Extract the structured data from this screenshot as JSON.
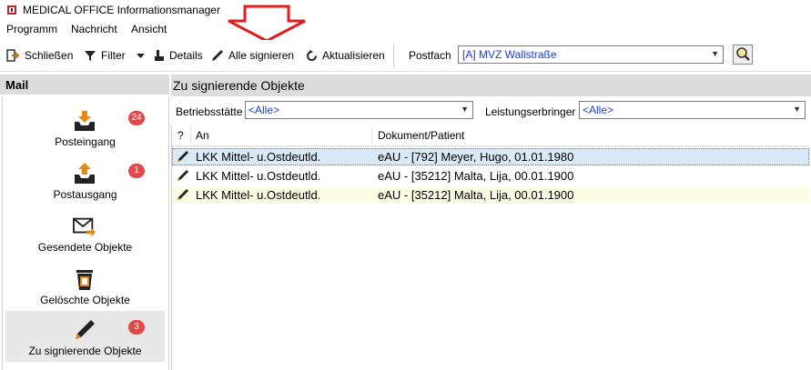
{
  "window": {
    "title": "MEDICAL OFFICE Informationsmanager"
  },
  "menu": [
    "Programm",
    "Nachricht",
    "Ansicht"
  ],
  "toolbar": {
    "close_label": "Schließen",
    "filter_label": "Filter",
    "details_label": "Details",
    "sign_all_label": "Alle signieren",
    "refresh_label": "Aktualisieren",
    "postfach_label": "Postfach",
    "postfach_value": "[A] MVZ Wallstraße"
  },
  "sidebar": {
    "title": "Mail",
    "items": [
      {
        "label": "Posteingang",
        "badge": "24",
        "icon": "inbox-icon"
      },
      {
        "label": "Postausgang",
        "badge": "1",
        "icon": "outbox-icon"
      },
      {
        "label": "Gesendete Objekte",
        "badge": "",
        "icon": "sent-mail-icon"
      },
      {
        "label": "Gelöschte Objekte",
        "badge": "",
        "icon": "trash-icon"
      },
      {
        "label": "Zu signierende Objekte",
        "badge": "3",
        "icon": "pen-icon"
      }
    ]
  },
  "main": {
    "title": "Zu signierende Objekte",
    "filters": {
      "betriebsstaette_label": "Betriebsstätte",
      "betriebsstaette_value": "<Alle>",
      "leistungserbringer_label": "Leistungserbringer",
      "leistungserbringer_value": "<Alle>"
    },
    "columns": {
      "flag": "?",
      "an": "An",
      "dokument": "Dokument/Patient"
    },
    "rows": [
      {
        "an": "LKK Mittel- u.Ostdeutld.",
        "dokument": "eAU - [792] Meyer, Hugo, 01.01.1980"
      },
      {
        "an": "LKK Mittel- u.Ostdeutld.",
        "dokument": "eAU - [35212] Malta, Lija, 00.01.1900"
      },
      {
        "an": "LKK Mittel- u.Ostdeutld.",
        "dokument": "eAU - [35212] Malta, Lija, 00.01.1900"
      }
    ]
  },
  "colors": {
    "accent_link": "#1f3fbf",
    "badge": "#e04a4a",
    "annotation_arrow": "#e01e1e",
    "selected_row": "#d9e9f7"
  }
}
